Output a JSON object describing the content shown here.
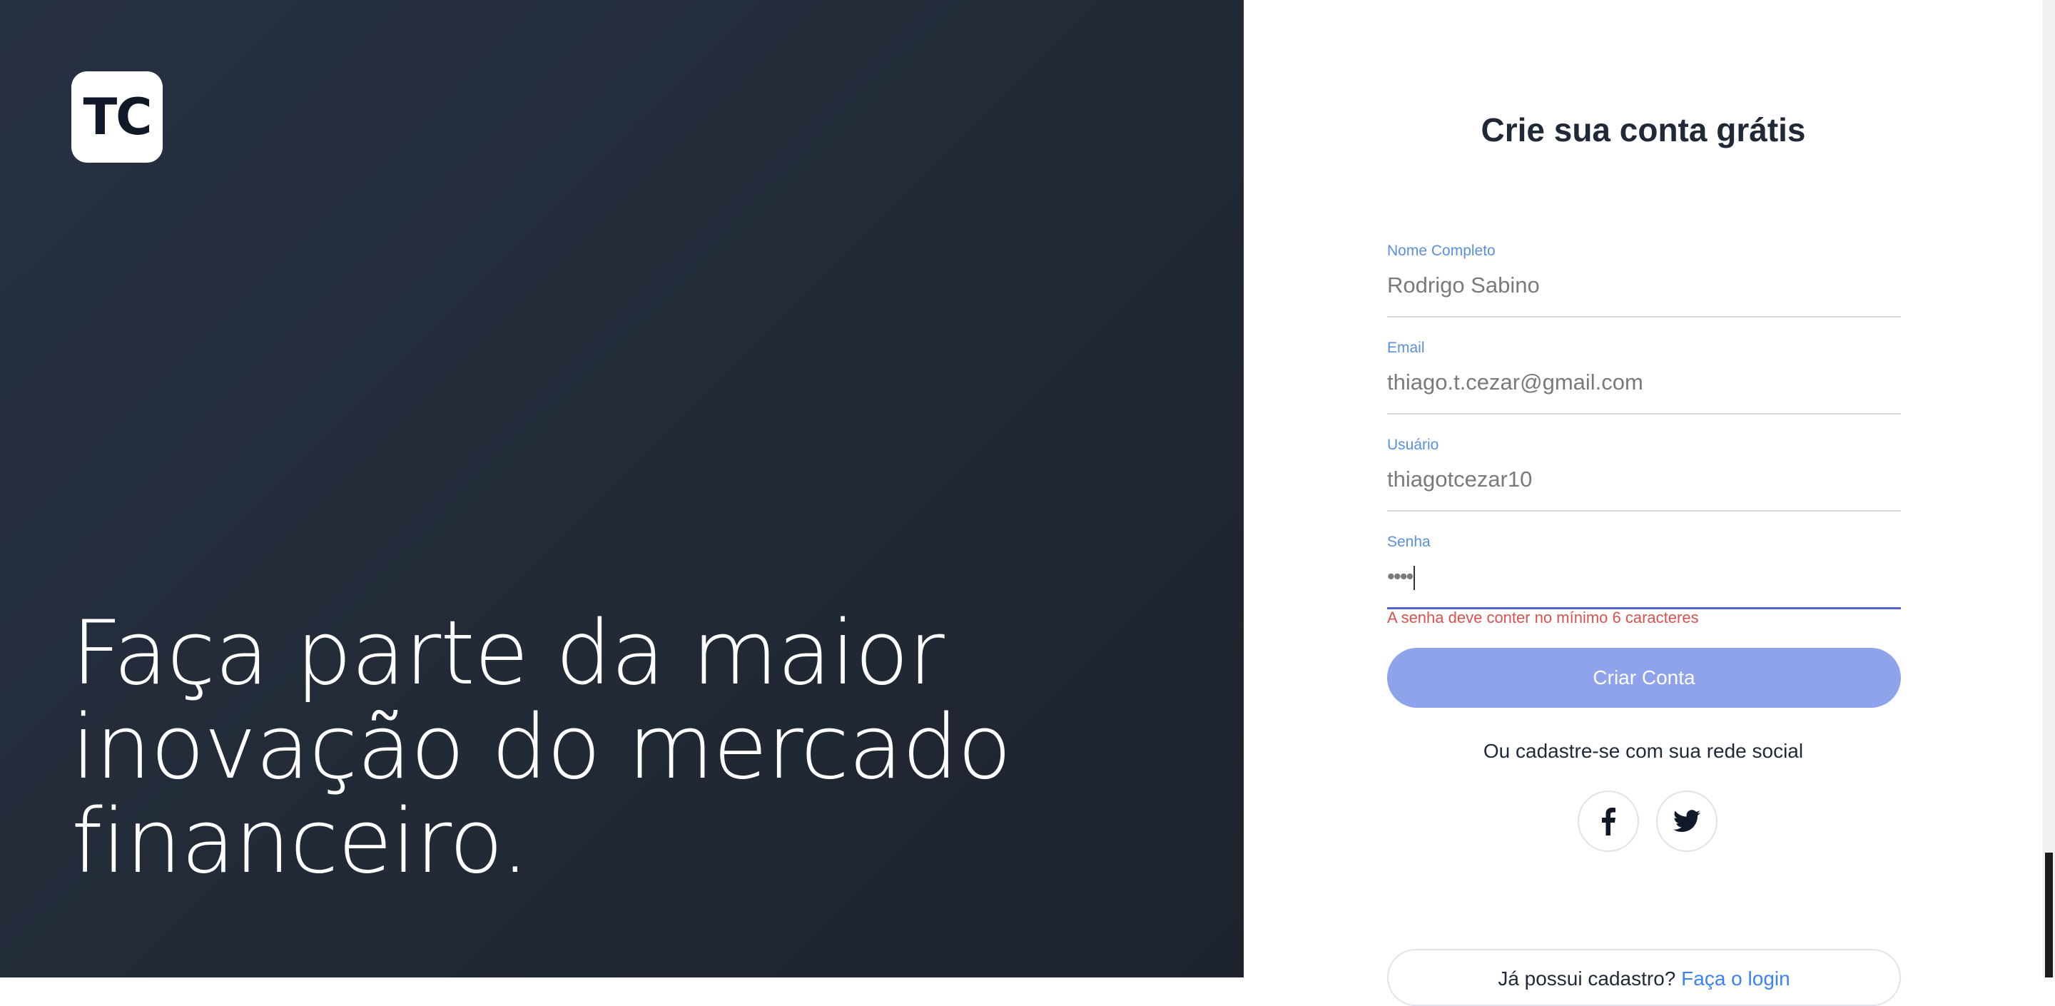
{
  "brand": {
    "logo_text": "TC"
  },
  "hero": {
    "lines": [
      "Faça parte da maior",
      "inovação do mercado",
      "financeiro."
    ]
  },
  "form": {
    "title": "Crie sua conta grátis",
    "fields": [
      {
        "label": "Nome Completo",
        "value": "Rodrigo Sabino"
      },
      {
        "label": "Email",
        "value": "thiago.t.cezar@gmail.com"
      },
      {
        "label": "Usuário",
        "value": "thiagotcezar10"
      },
      {
        "label": "Senha",
        "value": "••••"
      }
    ],
    "password_error": "A senha deve conter no mínimo 6 caracteres",
    "submit_label": "Criar Conta"
  },
  "social": {
    "prompt": "Ou cadastre-se com sua rede social",
    "facebook_icon": "facebook-icon",
    "twitter_icon": "twitter-icon"
  },
  "login": {
    "prompt": "Já possui cadastro?",
    "link": "Faça o login"
  },
  "colors": {
    "left_bg": "#252d3a",
    "accent": "#5b8fe0",
    "button": "#8fa3ec",
    "error": "#d9534f"
  }
}
